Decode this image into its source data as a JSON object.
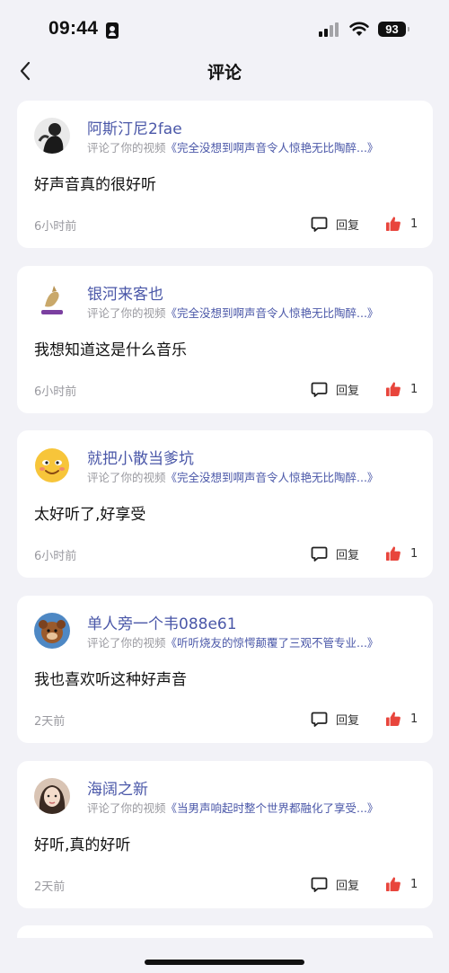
{
  "status_bar": {
    "time": "09:44",
    "battery": "93"
  },
  "header": {
    "title": "评论"
  },
  "labels": {
    "meta_prefix": "评论了你的视频",
    "reply": "回复"
  },
  "comments": [
    {
      "username": "阿斯汀尼2fae",
      "video_title": "《完全没想到啊声音令人惊艳无比陶醉...》",
      "text": "好声音真的很好听",
      "time_ago": "6小时前",
      "likes": "1"
    },
    {
      "username": "银河来客也",
      "video_title": "《完全没想到啊声音令人惊艳无比陶醉...》",
      "text": "我想知道这是什么音乐",
      "time_ago": "6小时前",
      "likes": "1"
    },
    {
      "username": "就把小散当爹坑",
      "video_title": "《完全没想到啊声音令人惊艳无比陶醉...》",
      "text": "太好听了,好享受",
      "time_ago": "6小时前",
      "likes": "1"
    },
    {
      "username": "单人旁一个韦088e61",
      "video_title": "《听听烧友的惊愕颠覆了三观不管专业...》",
      "text": "我也喜欢听这种好声音",
      "time_ago": "2天前",
      "likes": "1"
    },
    {
      "username": "海阔之新",
      "video_title": "《当男声响起时整个世界都融化了享受...》",
      "text": "好听,真的好听",
      "time_ago": "2天前",
      "likes": "1"
    }
  ],
  "colors": {
    "background": "#f2f2f7",
    "link": "#4a57a8",
    "like": "#e8453c"
  }
}
